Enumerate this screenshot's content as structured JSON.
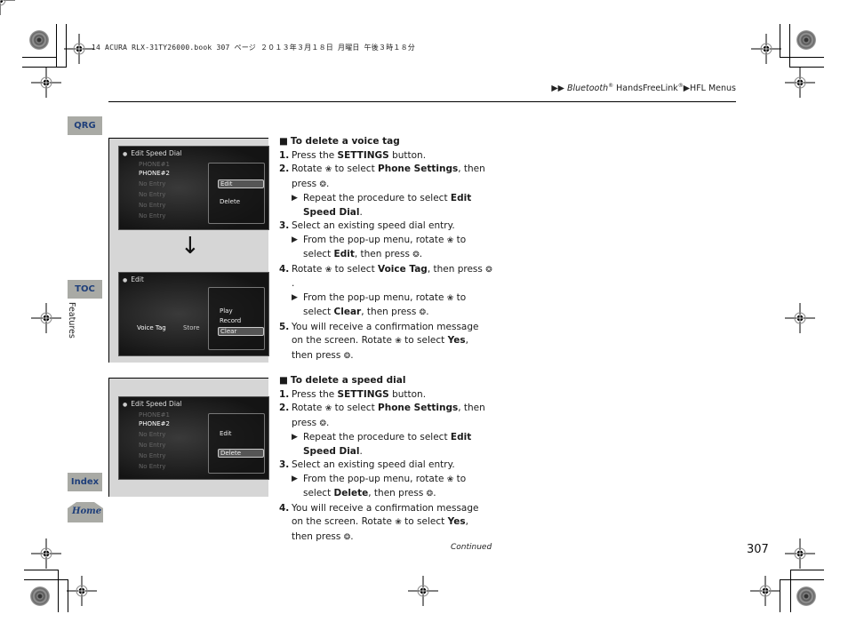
{
  "print_header": "14 ACURA RLX-31TY26000.book  307 ページ  ２０１３年３月１８日  月曜日  午後３時１８分",
  "breadcrumb": {
    "arrow": "▶▶",
    "part1": "Bluetooth",
    "reg1": "®",
    "part2": " HandsFreeLink",
    "reg2": "®",
    "arrow2": "▶",
    "part3": "HFL Menus"
  },
  "side_tabs": {
    "qrg": "QRG",
    "toc": "TOC",
    "section": "Features",
    "index": "Index",
    "home": "Home"
  },
  "figures": {
    "edit_speed_dial_1": {
      "title": "Edit Speed Dial",
      "rows": [
        "PHONE#1",
        "PHONE#2",
        "No Entry",
        "No Entry",
        "No Entry",
        "No Entry"
      ],
      "popup": [
        "Edit",
        "Delete"
      ],
      "highlighted": "Edit"
    },
    "arrow": "↓",
    "edit": {
      "title": "Edit",
      "row_label": "Voice Tag",
      "row_value": "Store",
      "popup": [
        "Play",
        "Record",
        "Clear"
      ],
      "highlighted": "Clear"
    },
    "edit_speed_dial_2": {
      "title": "Edit Speed Dial",
      "rows": [
        "PHONE#1",
        "PHONE#2",
        "No Entry",
        "No Entry",
        "No Entry",
        "No Entry"
      ],
      "popup": [
        "Edit",
        "Delete"
      ],
      "highlighted": "Delete"
    }
  },
  "icons": {
    "rotate": "❀",
    "press": "❂"
  },
  "section_voice_tag": {
    "heading": "To delete a voice tag",
    "steps": [
      {
        "num": "1.",
        "pre": "Press the ",
        "bold": "SETTINGS",
        "post": " button."
      },
      {
        "num": "2.",
        "pre": "Rotate ",
        "mid": " to select ",
        "bold": "Phone Settings",
        "post": ", then press "
      },
      {
        "sub": true,
        "pre": "Repeat the procedure to select ",
        "bold": "Edit Speed Dial",
        "post": "."
      },
      {
        "num": "3.",
        "text": "Select an existing speed dial entry."
      },
      {
        "sub": true,
        "pre": "From the pop-up menu, rotate ",
        "mid": " to select ",
        "bold": "Edit",
        "post": ", then press "
      },
      {
        "num": "4.",
        "pre": "Rotate ",
        "mid": " to select ",
        "bold": "Voice Tag",
        "post": ", then press "
      },
      {
        "sub": true,
        "pre": "From the pop-up menu, rotate ",
        "mid": " to select ",
        "bold": "Clear",
        "post": ", then press "
      },
      {
        "num": "5.",
        "pre": "You will receive a confirmation message on the screen. Rotate ",
        "mid": " to select ",
        "bold": "Yes",
        "post": ", then press "
      }
    ]
  },
  "section_speed_dial": {
    "heading": "To delete a speed dial",
    "steps": [
      {
        "num": "1.",
        "pre": "Press the ",
        "bold": "SETTINGS",
        "post": " button."
      },
      {
        "num": "2.",
        "pre": "Rotate ",
        "mid": " to select ",
        "bold": "Phone Settings",
        "post": ", then press "
      },
      {
        "sub": true,
        "pre": "Repeat the procedure to select ",
        "bold": "Edit Speed Dial",
        "post": "."
      },
      {
        "num": "3.",
        "text": "Select an existing speed dial entry."
      },
      {
        "sub": true,
        "pre": "From the pop-up menu, rotate ",
        "mid": " to select ",
        "bold": "Delete",
        "post": ", then press "
      },
      {
        "num": "4.",
        "pre": "You will receive a confirmation message on the screen. Rotate ",
        "mid": " to select ",
        "bold": "Yes",
        "post": ", then press "
      }
    ]
  },
  "footer": {
    "continued": "Continued",
    "page_number": "307"
  }
}
